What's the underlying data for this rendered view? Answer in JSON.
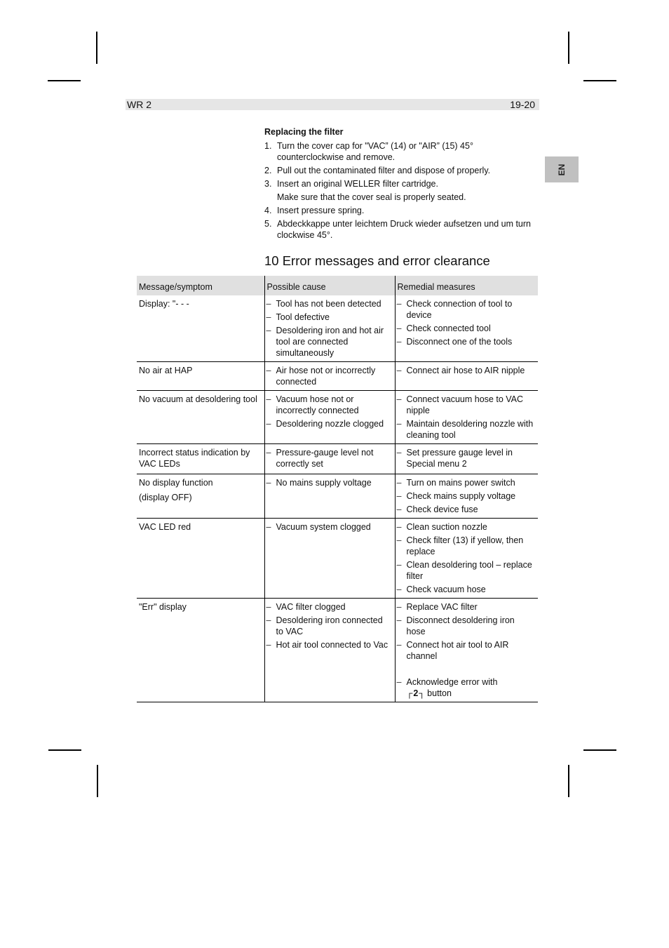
{
  "header": {
    "model": "WR 2",
    "page": "19-20"
  },
  "language_tab": "EN",
  "filter_section": {
    "title": "Replacing the filter",
    "steps": [
      {
        "num": "1.",
        "text": "Turn the cover cap for \"VAC” (14) or \"AIR” (15) 45° counterclockwise and remove."
      },
      {
        "num": "2.",
        "text": "Pull out the contaminated filter and dispose of properly."
      },
      {
        "num": "3.",
        "text": "Insert an original WELLER filter cartridge."
      },
      {
        "num": "",
        "text": "Make sure that the cover seal is properly seated."
      },
      {
        "num": "4.",
        "text": "Insert pressure spring."
      },
      {
        "num": "5.",
        "text": "Abdeckkappe unter leichtem Druck wieder aufsetzen und um turn clockwise 45°."
      }
    ]
  },
  "chapter_title": "10 Error messages and error clearance",
  "table": {
    "headers": [
      "Message/symptom",
      "Possible cause",
      "Remedial measures"
    ],
    "rows": [
      {
        "symptom": [
          "Display: \"- - -"
        ],
        "causes": [
          "Tool has not been detected",
          "Tool defective",
          "Desoldering iron and hot air tool are connected simultaneously"
        ],
        "measures": [
          "Check connection of tool to device",
          "Check connected tool",
          "Disconnect one of the tools"
        ]
      },
      {
        "symptom": [
          "No air at HAP"
        ],
        "causes": [
          "Air hose not or incorrectly connected"
        ],
        "measures": [
          "Connect air hose to AIR nipple"
        ]
      },
      {
        "symptom": [
          "No vacuum at desoldering tool"
        ],
        "causes": [
          "Vacuum hose not or incorrectly connected",
          "Desoldering nozzle clogged"
        ],
        "measures": [
          "Connect vacuum hose to VAC nipple",
          "Maintain desoldering nozzle with cleaning tool"
        ]
      },
      {
        "symptom": [
          "Incorrect status indication by VAC LEDs"
        ],
        "causes": [
          "Pressure-gauge level not correctly set"
        ],
        "measures": [
          "Set pressure gauge level in Special menu 2"
        ]
      },
      {
        "symptom": [
          "No display function",
          "(display OFF)"
        ],
        "causes": [
          "No mains supply voltage"
        ],
        "measures": [
          "Turn on mains power switch",
          "Check mains supply voltage",
          "Check device fuse"
        ]
      },
      {
        "symptom": [
          "VAC LED red"
        ],
        "causes": [
          "Vacuum system clogged"
        ],
        "measures": [
          "Clean suction nozzle",
          "Check filter (13) if yellow, then replace",
          "Clean desoldering tool – replace filter",
          "Check vacuum hose"
        ]
      },
      {
        "symptom": [
          "\"Err\" display"
        ],
        "causes": [
          "VAC filter clogged",
          "Desoldering iron connected to VAC",
          "Hot air tool connected to Vac"
        ],
        "measures": [
          "Replace VAC filter",
          "Disconnect desoldering iron hose",
          "Connect hot air tool to AIR channel"
        ],
        "acknowledge": {
          "text": "Acknowledge error with",
          "button_glyph": "┌2┐",
          "suffix": "button"
        }
      }
    ]
  }
}
